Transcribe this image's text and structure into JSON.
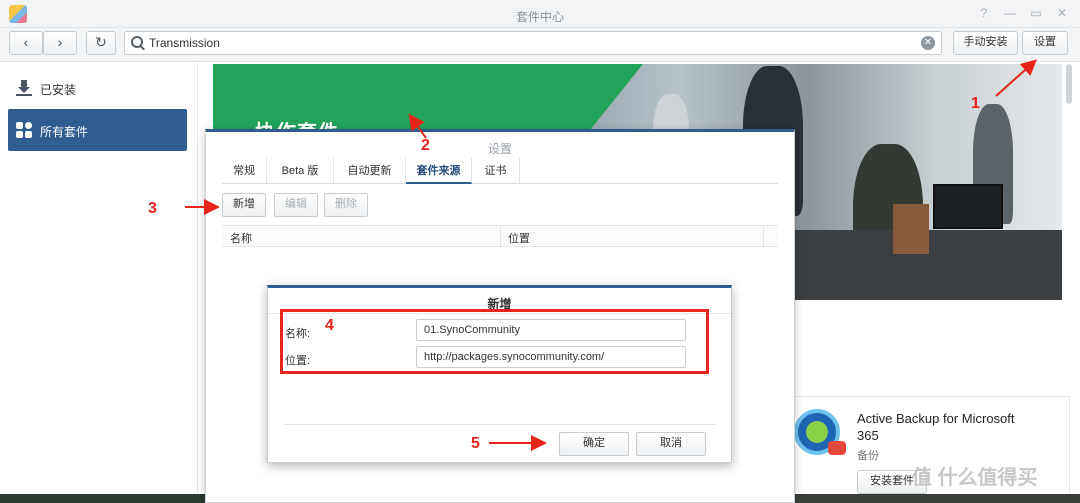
{
  "window": {
    "title": "套件中心",
    "controls": [
      "?",
      "—",
      "▭",
      "✕"
    ]
  },
  "toolbar": {
    "back_icon": "‹",
    "forward_icon": "›",
    "refresh_icon": "↻",
    "search_value": "Transmission",
    "manual_install_label": "手动安装",
    "settings_label": "设置"
  },
  "sidebar": {
    "items": [
      {
        "label": "已安装",
        "icon": "download-icon"
      },
      {
        "label": "所有套件",
        "icon": "grid-icon"
      }
    ]
  },
  "banner": {
    "title": "协作套件"
  },
  "package_card": {
    "name": "Active Backup for Microsoft 365",
    "category": "备份",
    "button": "安装套件"
  },
  "watermark": "值 什么值得买",
  "settings_dialog": {
    "title": "设置",
    "tabs": [
      "常规",
      "Beta 版",
      "自动更新",
      "套件来源",
      "证书"
    ],
    "active_tab": "套件来源",
    "buttons": {
      "add": "新增",
      "edit": "编辑",
      "delete": "删除"
    },
    "columns": [
      "名称",
      "位置"
    ]
  },
  "add_dialog": {
    "title": "新增",
    "name_label": "名称:",
    "name_value": "01.SynoCommunity",
    "location_label": "位置:",
    "location_value": "http://packages.synocommunity.com/",
    "ok": "确定",
    "cancel": "取消"
  },
  "annotations": {
    "n1": "1",
    "n2": "2",
    "n3": "3",
    "n4": "4",
    "n5": "5",
    "color": "#e8251b"
  },
  "colors": {
    "accent": "#2f5d90",
    "banner_green": "#21a35a"
  }
}
